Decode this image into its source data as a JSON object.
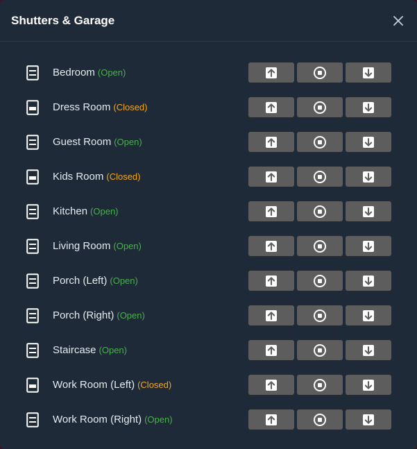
{
  "dialog": {
    "title": "Shutters & Garage",
    "close_icon": "close-icon"
  },
  "colors": {
    "panel": "#1e2a38",
    "button": "#5d5d5d",
    "open": "#4caf50",
    "closed": "#f5a623"
  },
  "icons": {
    "shutter": "window-shutter-icon",
    "up": "arrow-up-icon",
    "stop": "stop-circle-icon",
    "down": "arrow-down-icon"
  },
  "rooms": [
    {
      "name": "Bedroom",
      "status": "(Open)",
      "state": "open"
    },
    {
      "name": "Dress Room",
      "status": "(Closed)",
      "state": "closed"
    },
    {
      "name": "Guest Room",
      "status": "(Open)",
      "state": "open"
    },
    {
      "name": "Kids Room",
      "status": "(Closed)",
      "state": "closed"
    },
    {
      "name": "Kitchen",
      "status": "(Open)",
      "state": "open"
    },
    {
      "name": "Living Room",
      "status": "(Open)",
      "state": "open"
    },
    {
      "name": "Porch (Left)",
      "status": "(Open)",
      "state": "open"
    },
    {
      "name": "Porch (Right)",
      "status": "(Open)",
      "state": "open"
    },
    {
      "name": "Staircase",
      "status": "(Open)",
      "state": "open"
    },
    {
      "name": "Work Room (Left)",
      "status": "(Closed)",
      "state": "closed"
    },
    {
      "name": "Work Room (Right)",
      "status": "(Open)",
      "state": "open"
    }
  ]
}
